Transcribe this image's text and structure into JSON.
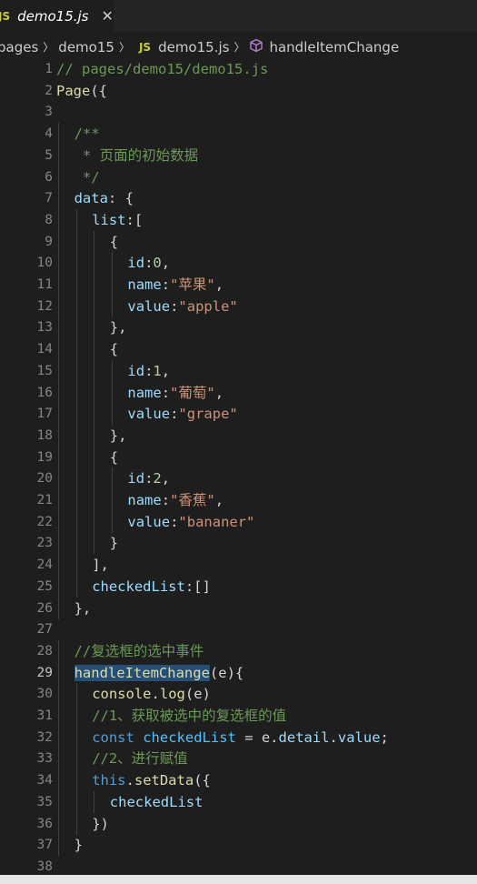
{
  "tab": {
    "icon_label": "JS",
    "filename": "demo15.js",
    "close_icon": "close-icon"
  },
  "breadcrumb": {
    "items": [
      "pages",
      "demo15",
      "demo15.js",
      "handleItemChange"
    ],
    "js_label": "JS"
  },
  "editor": {
    "active_line": 29,
    "lines": [
      {
        "n": "1",
        "indent": 0,
        "tokens": [
          [
            "comment",
            "// pages/demo15/demo15.js"
          ]
        ]
      },
      {
        "n": "2",
        "indent": 0,
        "tokens": [
          [
            "fn",
            "Page"
          ],
          [
            "punc",
            "({"
          ]
        ]
      },
      {
        "n": "3",
        "indent": 0,
        "tokens": []
      },
      {
        "n": "4",
        "indent": 1,
        "tokens": [
          [
            "comment",
            "/**"
          ]
        ]
      },
      {
        "n": "5",
        "indent": 1,
        "tokens": [
          [
            "comment",
            " * 页面的初始数据"
          ]
        ]
      },
      {
        "n": "6",
        "indent": 1,
        "tokens": [
          [
            "comment",
            " */"
          ]
        ]
      },
      {
        "n": "7",
        "indent": 1,
        "tokens": [
          [
            "key",
            "data"
          ],
          [
            "punc",
            ": {"
          ]
        ]
      },
      {
        "n": "8",
        "indent": 2,
        "tokens": [
          [
            "key",
            "list"
          ],
          [
            "punc",
            ":["
          ]
        ]
      },
      {
        "n": "9",
        "indent": 3,
        "tokens": [
          [
            "punc",
            "{"
          ]
        ]
      },
      {
        "n": "10",
        "indent": 4,
        "tokens": [
          [
            "key",
            "id"
          ],
          [
            "punc",
            ":"
          ],
          [
            "num",
            "0"
          ],
          [
            "punc",
            ","
          ]
        ]
      },
      {
        "n": "11",
        "indent": 4,
        "tokens": [
          [
            "key",
            "name"
          ],
          [
            "punc",
            ":"
          ],
          [
            "str",
            "\"苹果\""
          ],
          [
            "punc",
            ","
          ]
        ]
      },
      {
        "n": "12",
        "indent": 4,
        "tokens": [
          [
            "key",
            "value"
          ],
          [
            "punc",
            ":"
          ],
          [
            "str",
            "\"apple\""
          ]
        ]
      },
      {
        "n": "13",
        "indent": 3,
        "tokens": [
          [
            "punc",
            "},"
          ]
        ]
      },
      {
        "n": "14",
        "indent": 3,
        "tokens": [
          [
            "punc",
            "{"
          ]
        ]
      },
      {
        "n": "15",
        "indent": 4,
        "tokens": [
          [
            "key",
            "id"
          ],
          [
            "punc",
            ":"
          ],
          [
            "num",
            "1"
          ],
          [
            "punc",
            ","
          ]
        ]
      },
      {
        "n": "16",
        "indent": 4,
        "tokens": [
          [
            "key",
            "name"
          ],
          [
            "punc",
            ":"
          ],
          [
            "str",
            "\"葡萄\""
          ],
          [
            "punc",
            ","
          ]
        ]
      },
      {
        "n": "17",
        "indent": 4,
        "tokens": [
          [
            "key",
            "value"
          ],
          [
            "punc",
            ":"
          ],
          [
            "str",
            "\"grape\""
          ]
        ]
      },
      {
        "n": "18",
        "indent": 3,
        "tokens": [
          [
            "punc",
            "},"
          ]
        ]
      },
      {
        "n": "19",
        "indent": 3,
        "tokens": [
          [
            "punc",
            "{"
          ]
        ]
      },
      {
        "n": "20",
        "indent": 4,
        "tokens": [
          [
            "key",
            "id"
          ],
          [
            "punc",
            ":"
          ],
          [
            "num",
            "2"
          ],
          [
            "punc",
            ","
          ]
        ]
      },
      {
        "n": "21",
        "indent": 4,
        "tokens": [
          [
            "key",
            "name"
          ],
          [
            "punc",
            ":"
          ],
          [
            "str",
            "\"香蕉\""
          ],
          [
            "punc",
            ","
          ]
        ]
      },
      {
        "n": "22",
        "indent": 4,
        "tokens": [
          [
            "key",
            "value"
          ],
          [
            "punc",
            ":"
          ],
          [
            "str",
            "\"bananer\""
          ]
        ]
      },
      {
        "n": "23",
        "indent": 3,
        "tokens": [
          [
            "punc",
            "}"
          ]
        ]
      },
      {
        "n": "24",
        "indent": 2,
        "tokens": [
          [
            "punc",
            "],"
          ]
        ]
      },
      {
        "n": "25",
        "indent": 2,
        "tokens": [
          [
            "key",
            "checkedList"
          ],
          [
            "punc",
            ":[]"
          ]
        ]
      },
      {
        "n": "26",
        "indent": 1,
        "tokens": [
          [
            "punc",
            "},"
          ]
        ]
      },
      {
        "n": "27",
        "indent": 0,
        "tokens": []
      },
      {
        "n": "28",
        "indent": 1,
        "tokens": [
          [
            "comment",
            "//复选框的选中事件"
          ]
        ]
      },
      {
        "n": "29",
        "indent": 1,
        "tokens": [
          [
            "fn-sel",
            "handleItemChange"
          ],
          [
            "punc",
            "(e){"
          ]
        ]
      },
      {
        "n": "30",
        "indent": 2,
        "tokens": [
          [
            "fn",
            "console"
          ],
          [
            "punc",
            "."
          ],
          [
            "fn",
            "log"
          ],
          [
            "punc",
            "(e)"
          ]
        ]
      },
      {
        "n": "31",
        "indent": 2,
        "tokens": [
          [
            "comment",
            "//1、获取被选中的复选框的值"
          ]
        ]
      },
      {
        "n": "32",
        "indent": 2,
        "tokens": [
          [
            "kw",
            "const"
          ],
          [
            "punc",
            " "
          ],
          [
            "const",
            "checkedList"
          ],
          [
            "punc",
            " = e."
          ],
          [
            "key",
            "detail"
          ],
          [
            "punc",
            "."
          ],
          [
            "key",
            "value"
          ],
          [
            "punc",
            ";"
          ]
        ]
      },
      {
        "n": "33",
        "indent": 2,
        "tokens": [
          [
            "comment",
            "//2、进行赋值"
          ]
        ]
      },
      {
        "n": "34",
        "indent": 2,
        "tokens": [
          [
            "kw",
            "this"
          ],
          [
            "punc",
            "."
          ],
          [
            "fn",
            "setData"
          ],
          [
            "punc",
            "({"
          ]
        ]
      },
      {
        "n": "35",
        "indent": 3,
        "tokens": [
          [
            "key",
            "checkedList"
          ]
        ]
      },
      {
        "n": "36",
        "indent": 2,
        "tokens": [
          [
            "punc",
            "})"
          ]
        ]
      },
      {
        "n": "37",
        "indent": 1,
        "tokens": [
          [
            "punc",
            "}"
          ]
        ]
      },
      {
        "n": "38",
        "indent": 0,
        "tokens": []
      }
    ]
  },
  "colors": {
    "background": "#1e1e1e",
    "comment": "#6a9955",
    "function": "#dcdcaa",
    "property": "#9cdcfe",
    "string": "#ce9178",
    "number": "#b5cea8",
    "keyword": "#569cd6",
    "selection": "#264f78"
  }
}
